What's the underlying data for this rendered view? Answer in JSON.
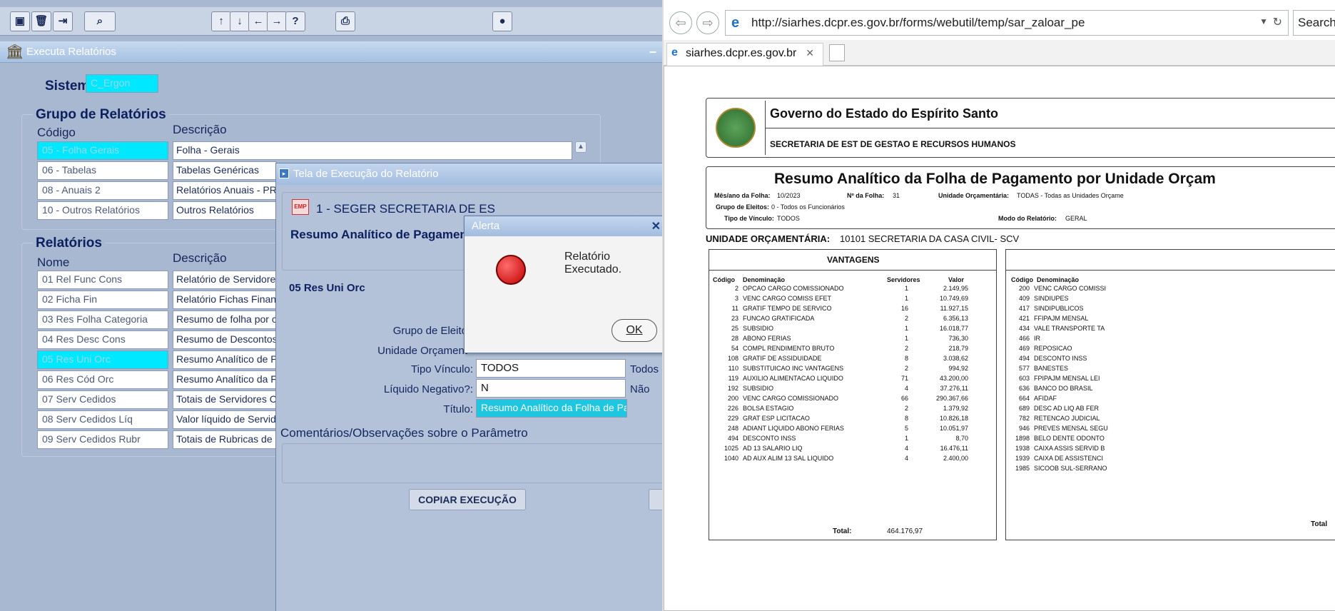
{
  "forms": {
    "window_title": "Executa Relatórios",
    "sistema_label": "Sistema",
    "sistema_value": "C_Ergon",
    "grupo_label": "Grupo de Relatórios",
    "codigo_label": "Código",
    "descricao_label": "Descrição",
    "grupos": [
      {
        "code": "05  -  Folha Gerais",
        "desc": "Folha - Gerais",
        "selected": true
      },
      {
        "code": "06  -  Tabelas",
        "desc": "Tabelas Genéricas",
        "selected": false
      },
      {
        "code": "08 - Anuais 2",
        "desc": "Relatórios Anuais - PRC",
        "selected": false
      },
      {
        "code": "10  -  Outros Relatórios",
        "desc": "Outros Relatórios",
        "selected": false
      }
    ],
    "relatorios_label": "Relatórios",
    "nome_label": "Nome",
    "descricao2_label": "Descrição",
    "relatorios": [
      {
        "name": "01 Rel Func Cons",
        "desc": "Relatório de Servidores",
        "selected": false
      },
      {
        "name": "02 Ficha Fin",
        "desc": "Relatório Fichas Financ",
        "selected": false
      },
      {
        "name": "03 Res Folha Categoria",
        "desc": "Resumo de folha por ca",
        "selected": false
      },
      {
        "name": "04 Res Desc Cons",
        "desc": "Resumo de Descontos",
        "selected": false
      },
      {
        "name": "05 Res Uni Orc",
        "desc": "Resumo Analítico de Pa",
        "selected": true
      },
      {
        "name": "06 Res Cód Orc",
        "desc": "Resumo Analítico da Fo",
        "selected": false
      },
      {
        "name": "07 Serv Cedidos",
        "desc": "Totais de Servidores Ce",
        "selected": false
      },
      {
        "name": "08 Serv Cedidos Líq",
        "desc": "Valor líquido de Servido",
        "selected": false
      },
      {
        "name": "09 Serv Cedidos Rubr",
        "desc": "Totais de Rubricas de S",
        "selected": false
      }
    ]
  },
  "exec": {
    "title": "Tela de Execução do Relatório",
    "org": "1 - SEGER SECRETARIA DE ES",
    "report_title": "Resumo Analítico de Pagament",
    "report_code": "05 Res Uni Orc",
    "grupo_eleitos_label": "Grupo de Eleito",
    "unidade_label": "Unidade Orçament",
    "tipo_vinculo_label": "Tipo Vínculo:",
    "tipo_vinculo_value": "TODOS",
    "tipo_vinculo_desc": "Todos c",
    "liquido_label": "Líquido Negativo?:",
    "liquido_value": "N",
    "liquido_desc": "Não",
    "titulo_label": "Título:",
    "titulo_value": "Resumo Analítico da Folha de Paga",
    "comentarios_label": "Comentários/Observações sobre o Parâmetro",
    "copiar_label": "COPIAR EXECUÇÃO",
    "emp_icon_text": "EMP"
  },
  "alert": {
    "title": "Alerta",
    "message": "Relatório Executado.",
    "ok_label": "OK"
  },
  "browser": {
    "url": "http://siarhes.dcpr.es.gov.br/forms/webutil/temp/sar_zaloar_pe",
    "search_label": "Search",
    "tab_title": "siarhes.dcpr.es.gov.br"
  },
  "report": {
    "gov_title": "Governo do Estado do Espírito Santo",
    "secretaria": "SECRETARIA DE EST DE GESTAO E RECURSOS HUMANOS",
    "main_title": "Resumo Analítico da Folha de Pagamento por Unidade Orçam",
    "mes_label": "Mês/ano da Folha:",
    "mes_value": "10/2023",
    "nfolha_label": "Nº da Folha:",
    "nfolha_value": "31",
    "unidade_label": "Unidade Orçamentária:",
    "unidade_value": "TODAS - Todas as Unidades Orçame",
    "grupo_label": "Grupo de Eleitos:",
    "grupo_value": "0 - Todos os Funcionários",
    "tipo_label": "Tipo de Vínculo:",
    "tipo_value": "TODOS",
    "modo_label": "Modo do Relatório:",
    "modo_value": "GERAL",
    "uo_label": "UNIDADE ORÇAMENTÁRIA:",
    "uo_value": "10101 SECRETARIA DA CASA CIVIL- SCV",
    "vantagens_title": "VANTAGENS",
    "col_codigo": "Código",
    "col_denominacao": "Denominação",
    "col_servidores": "Servidores",
    "col_valor": "Valor",
    "vantagens": [
      [
        "2",
        "OPCAO CARGO COMISSIONADO",
        "1",
        "2.149,95"
      ],
      [
        "3",
        "VENC CARGO COMISS EFET",
        "1",
        "10.749,69"
      ],
      [
        "11",
        "GRATIF TEMPO DE SERVICO",
        "16",
        "11.927,15"
      ],
      [
        "23",
        "FUNCAO GRATIFICADA",
        "2",
        "6.356,13"
      ],
      [
        "25",
        "SUBSIDIO",
        "1",
        "16.018,77"
      ],
      [
        "28",
        "ABONO FERIAS",
        "1",
        "736,30"
      ],
      [
        "54",
        "COMPL RENDIMENTO BRUTO",
        "2",
        "218,79"
      ],
      [
        "108",
        "GRATIF DE ASSIDUIDADE",
        "8",
        "3.038,62"
      ],
      [
        "110",
        "SUBSTITUICAO INC VANTAGENS",
        "2",
        "994,92"
      ],
      [
        "119",
        "AUXILIO ALIMENTACAO LIQUIDO",
        "71",
        "43.200,00"
      ],
      [
        "192",
        "SUBSIDIO",
        "4",
        "37.276,11"
      ],
      [
        "200",
        "VENC CARGO COMISSIONADO",
        "66",
        "290.367,66"
      ],
      [
        "226",
        "BOLSA ESTAGIO",
        "2",
        "1.379,92"
      ],
      [
        "229",
        "GRAT ESP LICITACAO",
        "8",
        "10.826,18"
      ],
      [
        "248",
        "ADIANT LIQUIDO ABONO FERIAS",
        "5",
        "10.051,97"
      ],
      [
        "494",
        "DESCONTO INSS",
        "1",
        "8,70"
      ],
      [
        "1025",
        "AD 13 SALARIO LIQ",
        "4",
        "16.476,11"
      ],
      [
        "1040",
        "AD AUX ALIM 13 SAL LIQUIDO",
        "4",
        "2.400,00"
      ]
    ],
    "total_label": "Total:",
    "total_value": "464.176,97",
    "descontos": [
      [
        "200",
        "VENC CARGO COMISSI"
      ],
      [
        "409",
        "SINDIUPES"
      ],
      [
        "417",
        "SINDIPUBLICOS"
      ],
      [
        "421",
        "FFIPAJM MENSAL"
      ],
      [
        "434",
        "VALE TRANSPORTE TA"
      ],
      [
        "466",
        "IR"
      ],
      [
        "469",
        "REPOSICAO"
      ],
      [
        "494",
        "DESCONTO INSS"
      ],
      [
        "577",
        "BANESTES"
      ],
      [
        "603",
        "FPIPAJM MENSAL LEI"
      ],
      [
        "636",
        "BANCO DO BRASIL"
      ],
      [
        "664",
        "AFIDAF"
      ],
      [
        "689",
        "DESC AD LIQ AB FER"
      ],
      [
        "782",
        "RETENCAO JUDICIAL"
      ],
      [
        "946",
        "PREVES MENSAL SEGU"
      ],
      [
        "1898",
        "BELO DENTE ODONTO"
      ],
      [
        "1938",
        "CAIXA ASSIS SERVID B"
      ],
      [
        "1939",
        "CAIXA DE ASSISTENCI"
      ],
      [
        "1985",
        "SICOOB SUL-SERRANO"
      ]
    ],
    "total2_label": "Total"
  }
}
